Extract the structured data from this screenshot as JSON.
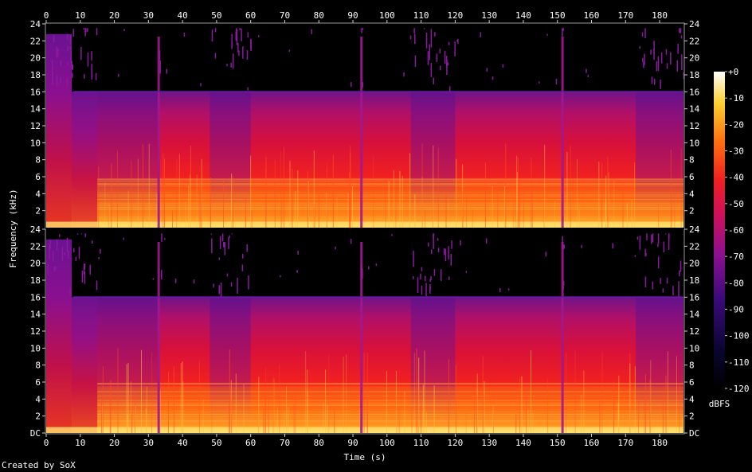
{
  "chart_data": {
    "type": "heatmap",
    "x_axis": {
      "label": "Time (s)",
      "ticks": [
        "0",
        "10",
        "20",
        "30",
        "40",
        "50",
        "60",
        "70",
        "80",
        "90",
        "100",
        "110",
        "120",
        "130",
        "140",
        "150",
        "160",
        "170",
        "180"
      ],
      "range": [
        0,
        187
      ]
    },
    "y_axis": {
      "label": "Frequency (kHz)",
      "top_channel_ticks": [
        "24",
        "22",
        "20",
        "18",
        "16",
        "14",
        "12",
        "10",
        "8",
        "6",
        "4",
        "2"
      ],
      "bottom_channel_ticks": [
        "24",
        "22",
        "20",
        "18",
        "16",
        "14",
        "12",
        "10",
        "8",
        "6",
        "4",
        "2",
        "DC"
      ],
      "range_khz": [
        0,
        24
      ]
    },
    "channels": 2,
    "colorbar": {
      "label": "dBFS",
      "ticks": [
        "+0",
        "-10",
        "-20",
        "-30",
        "-40",
        "-50",
        "-60",
        "-70",
        "-80",
        "-90",
        "-100",
        "-110",
        "-120"
      ],
      "range": [
        -120,
        0
      ]
    },
    "features": {
      "lowpass_cutoff_khz": 16,
      "hf_bursts_s": [
        [
          0,
          8
        ],
        [
          7,
          15
        ],
        [
          33,
          34
        ],
        [
          48,
          60
        ],
        [
          92,
          93
        ],
        [
          107,
          120
        ],
        [
          151,
          152
        ],
        [
          173,
          187
        ]
      ],
      "transients_s": [
        33,
        92.5,
        151.5
      ],
      "quiet_intro_end_s": 15
    },
    "colors": {
      "background": "#000000",
      "text": "#ffffff"
    },
    "credit": "Created by SoX"
  }
}
